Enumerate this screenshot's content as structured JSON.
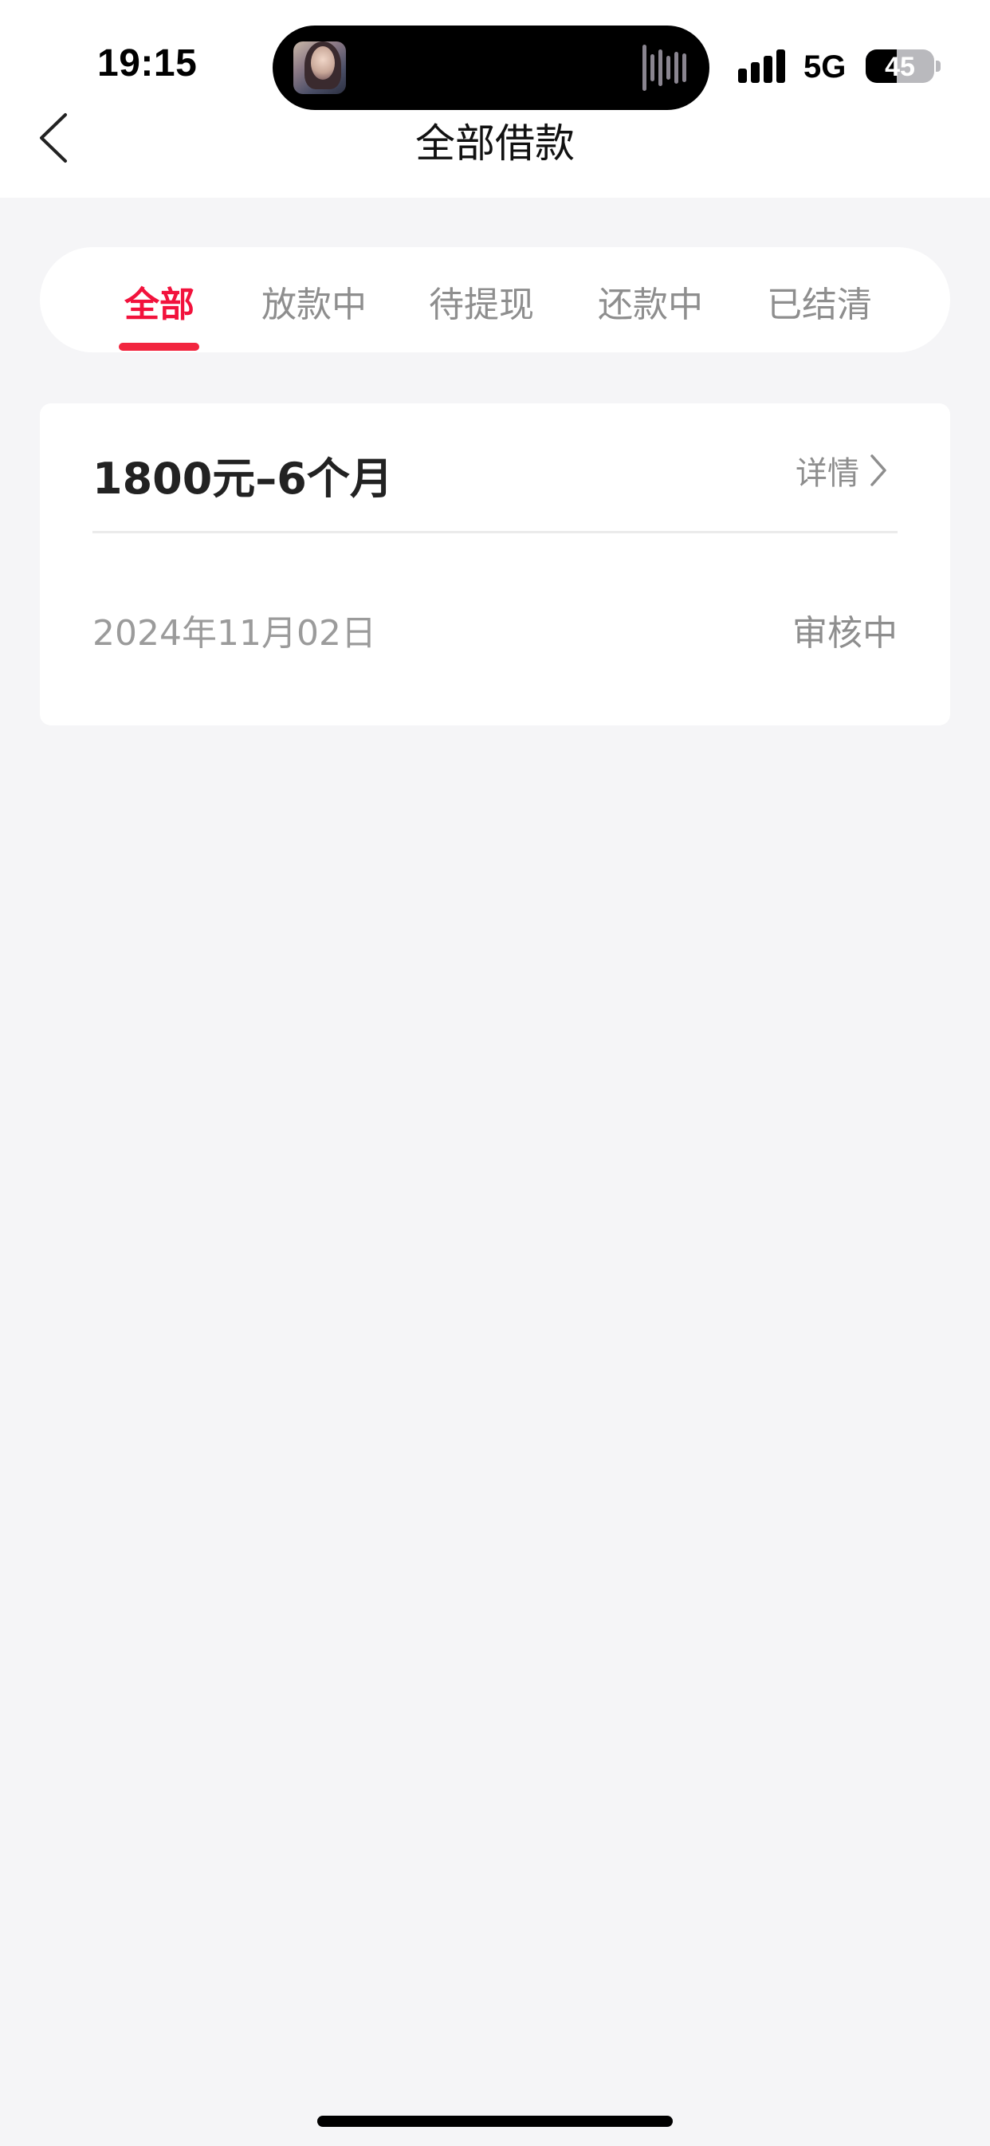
{
  "status_bar": {
    "time": "19:15",
    "network": "5G",
    "battery_level": "45",
    "battery_fraction": 0.45,
    "signal_icon": "signal-bars-icon"
  },
  "dynamic_island": {
    "thumbnail_icon": "media-thumbnail",
    "activity_icon": "audio-waveform-icon"
  },
  "nav": {
    "title": "全部借款",
    "back_icon": "chevron-left-icon"
  },
  "tabs": [
    {
      "label": "全部",
      "active": true
    },
    {
      "label": "放款中",
      "active": false
    },
    {
      "label": "待提现",
      "active": false
    },
    {
      "label": "还款中",
      "active": false
    },
    {
      "label": "已结清",
      "active": false
    }
  ],
  "loan_card": {
    "title": "1800元–6个月",
    "detail_label": "详情",
    "detail_icon": "chevron-right-icon",
    "date": "2024年11月02日",
    "status": "审核中"
  },
  "colors": {
    "accent": "#f2123c",
    "page_background": "#f5f5f7",
    "muted_text": "#8e8e8e"
  }
}
